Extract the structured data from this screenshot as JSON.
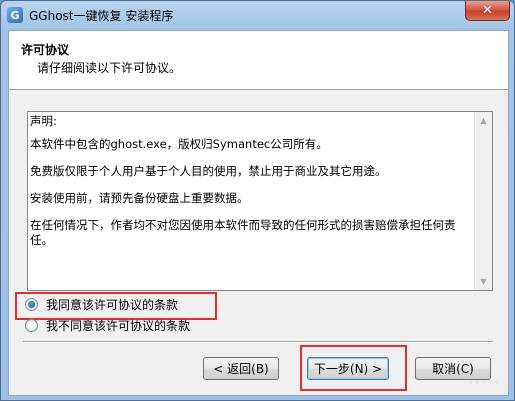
{
  "window": {
    "title": "GGhost一键恢复 安装程序",
    "close_glyph": "✕"
  },
  "header": {
    "title": "许可协议",
    "subtitle": "请仔细阅读以下许可协议。"
  },
  "license": {
    "paragraphs": [
      "声明:",
      "本软件中包含的ghost.exe，版权归Symantec公司所有。",
      "免费版仅限于个人用户基于个人目的使用，禁止用于商业及其它用途。",
      "安装使用前，请预先备份硬盘上重要数据。",
      "在任何情况下，作者均不对您因使用本软件而导致的任何形式的损害赔偿承担任何责任。"
    ]
  },
  "options": {
    "agree": {
      "label": "我同意该许可协议的条款",
      "checked": true
    },
    "disagree": {
      "label": "我不同意该许可协议的条款",
      "checked": false
    }
  },
  "buttons": {
    "back": "< 返回(B)",
    "next": "下一步(N) >",
    "cancel": "取消(C)"
  },
  "watermark": "◦◦◦◦◦"
}
